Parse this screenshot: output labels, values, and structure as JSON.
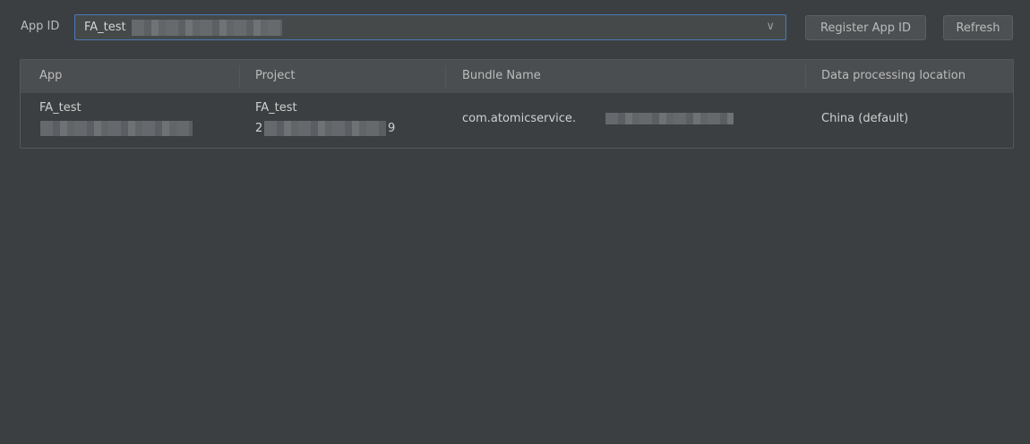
{
  "toolbar": {
    "app_id_label": "App ID",
    "app_id_value": "FA_test",
    "register_label": "Register App ID",
    "refresh_label": "Refresh",
    "dropdown_icon": "chevron-down-icon"
  },
  "table": {
    "headers": [
      "App",
      "Project",
      "Bundle Name",
      "Data processing location"
    ],
    "rows": [
      {
        "app_name": "FA_test",
        "project_name": "FA_test",
        "project_id_start": "2",
        "project_id_end": "9",
        "bundle_prefix": "com.atomicservice.",
        "location": "China (default)"
      }
    ]
  },
  "colors": {
    "background": "#3c3f41",
    "header_bg": "#4b4e50",
    "focus_border": "#4e7ab5",
    "button_bg": "#4c5052"
  }
}
